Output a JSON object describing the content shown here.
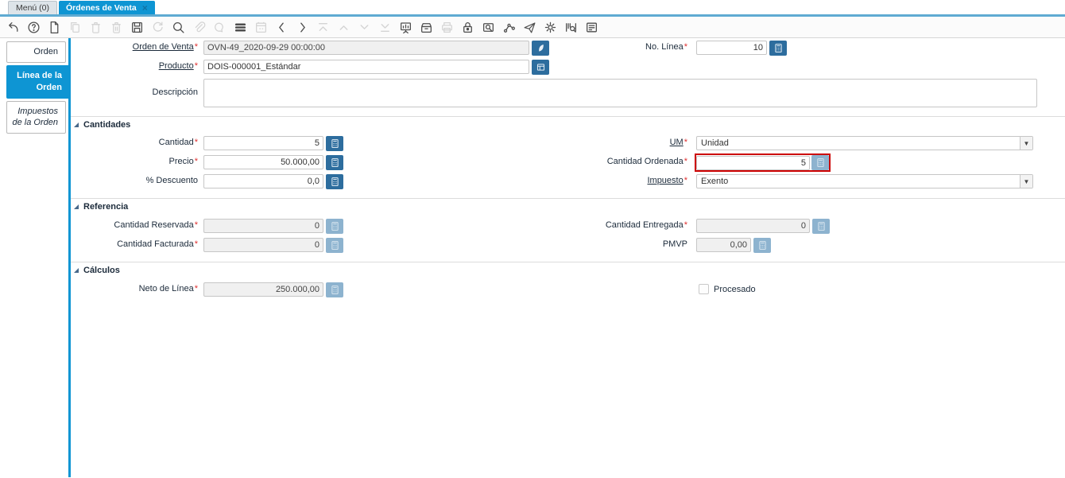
{
  "ui": {
    "close_glyph": "×",
    "dropdown_arrow": "▼",
    "required_marker": "*"
  },
  "colors": {
    "accent_blue": "#0e95d3",
    "button_blue": "#2d6d9e",
    "disabled_button_blue": "#8db3cf",
    "highlight_red": "#cc0000",
    "disabled_field_bg": "#f0f0f0"
  },
  "window": {
    "tabs": [
      {
        "label": "Menú (0)",
        "active": false
      },
      {
        "label": "Órdenes de Venta",
        "active": true,
        "closable": true
      }
    ]
  },
  "toolbar": {
    "items": [
      {
        "name": "undo",
        "enabled": true
      },
      {
        "name": "help",
        "enabled": true
      },
      {
        "name": "new-record",
        "enabled": true
      },
      {
        "name": "copy-record",
        "enabled": false
      },
      {
        "name": "delete-record",
        "enabled": false
      },
      {
        "name": "delete-selection",
        "enabled": false
      },
      {
        "name": "save",
        "enabled": true
      },
      {
        "name": "refresh",
        "enabled": false
      },
      {
        "name": "find",
        "enabled": true
      },
      {
        "name": "attachment",
        "enabled": false
      },
      {
        "name": "chat",
        "enabled": false
      },
      {
        "name": "grid-toggle",
        "enabled": true
      },
      {
        "name": "calendar",
        "enabled": false
      },
      {
        "name": "previous-record",
        "enabled": true
      },
      {
        "name": "next-record",
        "enabled": true
      },
      {
        "name": "first-record",
        "enabled": false
      },
      {
        "name": "parent-record",
        "enabled": false
      },
      {
        "name": "detail-record",
        "enabled": false
      },
      {
        "name": "last-record",
        "enabled": false
      },
      {
        "name": "report",
        "enabled": true
      },
      {
        "name": "archive",
        "enabled": true
      },
      {
        "name": "print",
        "enabled": false
      },
      {
        "name": "private-record-lock",
        "enabled": true
      },
      {
        "name": "zoom-across",
        "enabled": true
      },
      {
        "name": "workflow",
        "enabled": true
      },
      {
        "name": "send-request",
        "enabled": true
      },
      {
        "name": "preferences",
        "enabled": true
      },
      {
        "name": "product-info",
        "enabled": true
      },
      {
        "name": "report-window",
        "enabled": true
      }
    ]
  },
  "sidebar": {
    "tabs": [
      {
        "label": "Orden",
        "active": false
      },
      {
        "label": "Línea de la Orden",
        "active": true
      },
      {
        "label": "Impuestos de la Orden",
        "active": false,
        "italic": true
      }
    ]
  },
  "form": {
    "sections": {
      "cantidades": "Cantidades",
      "referencia": "Referencia",
      "calculos": "Cálculos"
    },
    "fields": {
      "orden_de_venta": {
        "label": "Orden de Venta",
        "value": "OVN-49_2020-09-29 00:00:00",
        "required": true
      },
      "no_linea": {
        "label": "No. Línea",
        "value": "10",
        "required": true
      },
      "producto": {
        "label": "Producto",
        "value": "DOIS-000001_Estándar",
        "required": true
      },
      "descripcion": {
        "label": "Descripción",
        "value": ""
      },
      "cantidad": {
        "label": "Cantidad",
        "value": "5",
        "required": true
      },
      "um": {
        "label": "UM",
        "value": "Unidad",
        "required": true
      },
      "precio": {
        "label": "Precio",
        "value": "50.000,00",
        "required": true
      },
      "cantidad_ordenada": {
        "label": "Cantidad Ordenada",
        "value": "5",
        "required": true,
        "highlighted": true
      },
      "descuento": {
        "label": "% Descuento",
        "value": "0,0"
      },
      "impuesto": {
        "label": "Impuesto",
        "value": "Exento",
        "required": true
      },
      "cantidad_reservada": {
        "label": "Cantidad Reservada",
        "value": "0",
        "required": true,
        "disabled": true
      },
      "cantidad_entregada": {
        "label": "Cantidad Entregada",
        "value": "0",
        "required": true,
        "disabled": true
      },
      "cantidad_facturada": {
        "label": "Cantidad Facturada",
        "value": "0",
        "required": true,
        "disabled": true
      },
      "pmvp": {
        "label": "PMVP",
        "value": "0,00",
        "disabled": true
      },
      "neto_de_linea": {
        "label": "Neto de Línea",
        "value": "250.000,00",
        "required": true,
        "disabled": true
      },
      "procesado": {
        "label": "Procesado",
        "checked": false
      }
    }
  }
}
